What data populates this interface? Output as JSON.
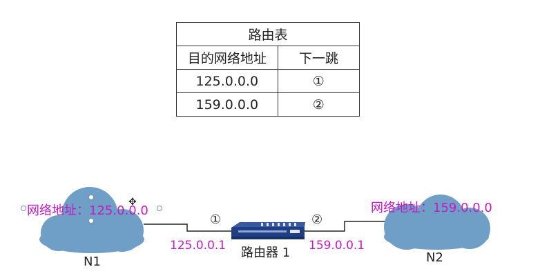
{
  "route_table": {
    "title": "路由表",
    "headers": [
      "目的网络地址",
      "下一跳"
    ],
    "rows": [
      [
        "125.0.0.0",
        "①"
      ],
      [
        "159.0.0.0",
        "②"
      ]
    ]
  },
  "network_left": {
    "address_text": "网络地址：125.0.0.0",
    "name": "N1"
  },
  "network_right": {
    "address_text": "网络地址：159.0.0.0",
    "name": "N2"
  },
  "router": {
    "name": "路由器 1",
    "port1_marker": "①",
    "port2_marker": "②",
    "port1_ip": "125.0.0.1",
    "port2_ip": "159.0.0.1"
  },
  "colors": {
    "cloud": "#6f9fc6",
    "address_text": "#c21bc2",
    "router_body": "#1f3f82",
    "router_light": "#dfe8ff",
    "line": "#222222"
  },
  "icons": [
    "cloud-icon",
    "router-icon",
    "move-cursor-icon"
  ]
}
